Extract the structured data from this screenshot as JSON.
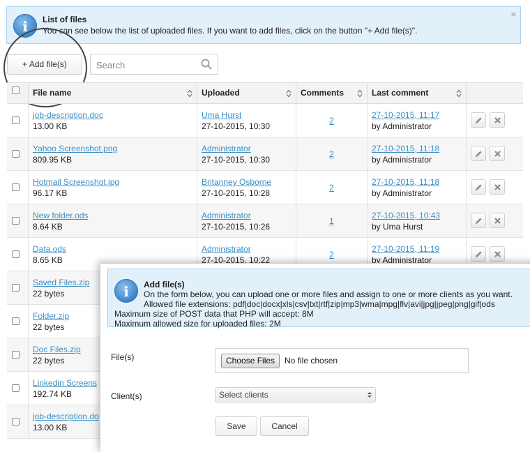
{
  "banner": {
    "title": "List of files",
    "text": "You can see below the list of uploaded files. If you want to add files, click on the button \"+ Add file(s)\".",
    "close": "×"
  },
  "toolbar": {
    "add_label": "+ Add file(s)",
    "search_placeholder": "Search"
  },
  "table": {
    "columns": [
      "File name",
      "Uploaded",
      "Comments",
      "Last comment"
    ],
    "rows": [
      {
        "name": "job-description.doc",
        "size": "13.00 KB",
        "uploader": "Uma Hurst",
        "uploaded": "27-10-2015, 10:30",
        "comments": "2",
        "last_date": "27-10-2015, 11:17",
        "last_by": "by Administrator"
      },
      {
        "name": "Yahoo Screenshot.png",
        "size": "809.95 KB",
        "uploader": "Administrator",
        "uploaded": "27-10-2015, 10:30",
        "comments": "2",
        "last_date": "27-10-2015, 11:18",
        "last_by": "by Administrator"
      },
      {
        "name": "Hotmail Screenshot.jpg",
        "size": "96.17 KB",
        "uploader": "Britanney Osborne",
        "uploaded": "27-10-2015, 10:28",
        "comments": "2",
        "last_date": "27-10-2015, 11:18",
        "last_by": "by Administrator"
      },
      {
        "name": "New folder.ods",
        "size": "8.64 KB",
        "uploader": "Administrator",
        "uploaded": "27-10-2015, 10:26",
        "comments": "1",
        "last_date": "27-10-2015, 10:43",
        "last_by": "by Uma Hurst"
      },
      {
        "name": "Data.ods",
        "size": "8.65 KB",
        "uploader": "Administrator",
        "uploaded": "27-10-2015, 10:22",
        "comments": "2",
        "last_date": "27-10-2015, 11:19",
        "last_by": "by Administrator"
      },
      {
        "name": "Saved Files.zip",
        "size": "22 bytes"
      },
      {
        "name": "Folder.zip",
        "size": "22 bytes"
      },
      {
        "name": "Doc Files.zip",
        "size": "22 bytes"
      },
      {
        "name": "Linkedin Screens",
        "size": "192.74 KB"
      },
      {
        "name": "job-description.do",
        "size": "13.00 KB"
      }
    ]
  },
  "modal": {
    "title": "Add file(s)",
    "lines": [
      "On the form below, you can upload one or more files and assign to one or more clients as you want.",
      "Allowed file extensions: pdf|doc|docx|xls|csv|txt|rtf|zip|mp3|wma|mpg|flv|avi|jpg|jpeg|png|gif|ods",
      "Maximum size of POST data that PHP will accept: 8M",
      "Maximum allowed size for uploaded files: 2M"
    ],
    "files_label": "File(s)",
    "choose_label": "Choose Files",
    "no_file": "No file chosen",
    "clients_label": "Client(s)",
    "clients_select": "Select clients",
    "save_label": "Save",
    "cancel_label": "Cancel"
  }
}
